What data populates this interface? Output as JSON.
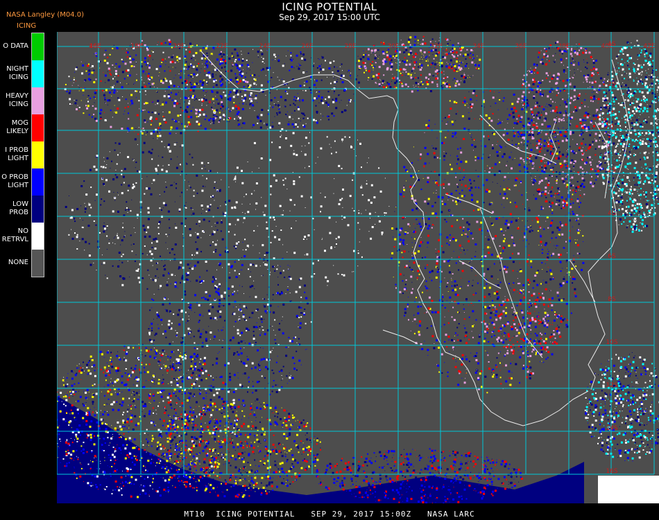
{
  "header": {
    "title": "ICING POTENTIAL",
    "date": "Sep 29, 2017 15:00 UTC",
    "provider": "NASA Langley (M04.0)",
    "product": "ICING"
  },
  "legend": {
    "items": [
      {
        "label": "O DATA",
        "color": "#00cc00"
      },
      {
        "label": "NIGHT ICING",
        "color": "#00ffff"
      },
      {
        "label": "HEAVY ICING",
        "color": "#e8a0e0"
      },
      {
        "label": "MOG LIKELY",
        "color": "#ff0000"
      },
      {
        "label": "I PROB LIGHT",
        "color": "#ffff00"
      },
      {
        "label": "O PROB LIGHT",
        "color": "#0000ff"
      },
      {
        "label": "LOW PROB",
        "color": "#000080"
      },
      {
        "label": "NO RETRVL",
        "color": "#ffffff"
      },
      {
        "label": "NONE",
        "color": "#555555"
      }
    ]
  },
  "map": {
    "background": "#4d4d4d",
    "grid_color": "#00c8d8",
    "label_color": "#c81e1e",
    "top_labels": [
      "16E",
      "18E",
      "20E",
      "22E",
      "24E",
      "26E",
      "28E",
      "30E",
      "32E",
      "34E",
      "36E",
      "38E",
      "40E",
      "42E",
      "44E",
      "46E"
    ],
    "right_labels": [
      "4S",
      "2S",
      "0",
      "2S",
      "4S",
      "6S",
      "8S",
      "10S",
      "12S",
      "14S",
      "16S",
      "18S",
      "20S",
      "22S"
    ]
  },
  "footer": {
    "text": "MT10  ICING POTENTIAL   SEP 29, 2017 15:00Z   NASA LARC"
  }
}
